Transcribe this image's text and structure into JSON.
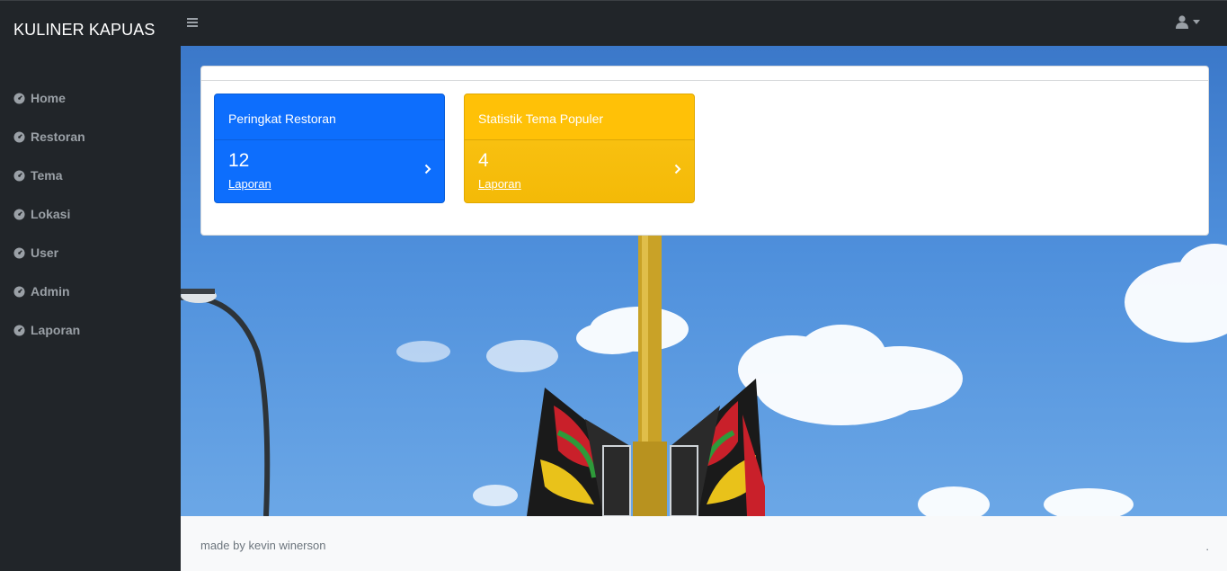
{
  "app": {
    "brand": "KULINER KAPUAS"
  },
  "sidebar": {
    "items": [
      {
        "label": "Home",
        "icon": "tachometer-icon"
      },
      {
        "label": "Restoran",
        "icon": "tachometer-icon"
      },
      {
        "label": "Tema",
        "icon": "tachometer-icon"
      },
      {
        "label": "Lokasi",
        "icon": "tachometer-icon"
      },
      {
        "label": "User",
        "icon": "tachometer-icon"
      },
      {
        "label": "Admin",
        "icon": "tachometer-icon"
      },
      {
        "label": "Laporan",
        "icon": "tachometer-icon"
      }
    ]
  },
  "header": {
    "toggle_icon": "hamburger-icon",
    "user_icon": "user-icon"
  },
  "tiles": [
    {
      "title": "Peringkat Restoran",
      "value": "12",
      "link": "Laporan",
      "color": "#0d6efd"
    },
    {
      "title": "Statistik Tema Populer",
      "value": "4",
      "link": "Laporan",
      "color": "#ffc107"
    }
  ],
  "footer": {
    "text": "made by kevin winerson",
    "dot": "."
  }
}
